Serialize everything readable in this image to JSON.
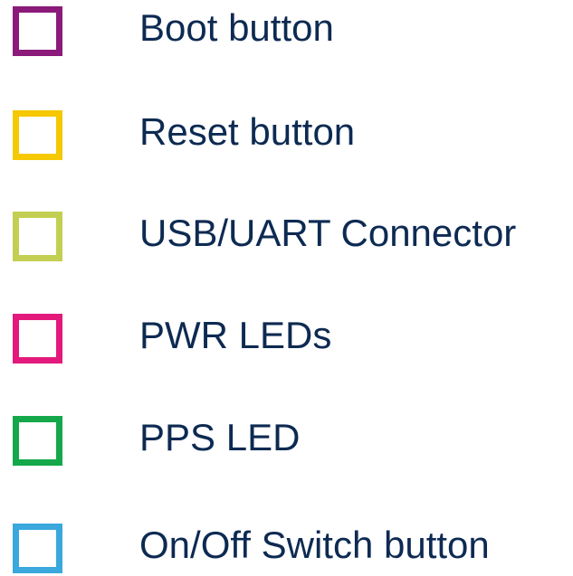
{
  "legend": {
    "items": [
      {
        "label": "Boot button",
        "color": "#8b1a7a"
      },
      {
        "label": "Reset button",
        "color": "#f5c800"
      },
      {
        "label": "USB/UART Connector",
        "color": "#c3cf52"
      },
      {
        "label": "PWR LEDs",
        "color": "#e3197c"
      },
      {
        "label": "PPS LED",
        "color": "#14a84a"
      },
      {
        "label": "On/Off Switch button",
        "color": "#3aa8dc"
      }
    ]
  }
}
